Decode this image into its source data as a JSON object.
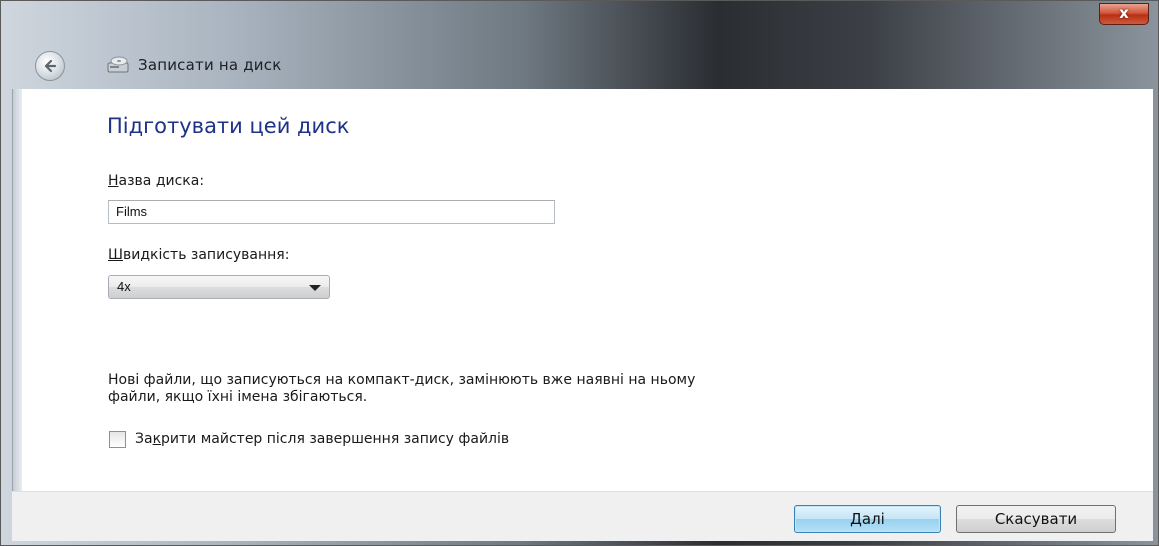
{
  "window": {
    "title": "Записати на диск",
    "close_label": "x"
  },
  "main": {
    "heading": "Підготувати цей диск",
    "disc_name_label": {
      "accel": "Н",
      "rest": "азва диска:"
    },
    "disc_name_value": "Films",
    "speed_label": {
      "accel": "Ш",
      "rest": "видкість записування:"
    },
    "speed_value": "4x",
    "note_line1": "Нові файли, що записуються на компакт-диск, замінюють вже наявні на ньому",
    "note_line2": "файли, якщо їхні імена збігаються.",
    "checkbox_label": {
      "pre": "За",
      "accel": "к",
      "rest": "рити майстер після завершення запису файлів"
    },
    "checkbox_checked": false
  },
  "footer": {
    "next_label": {
      "accel": "Д",
      "rest": "алі"
    },
    "cancel_label": "Скасувати"
  },
  "colors": {
    "heading": "#1e3287",
    "close_button": "#c4381b",
    "primary_button_border": "#3c7fb1"
  }
}
